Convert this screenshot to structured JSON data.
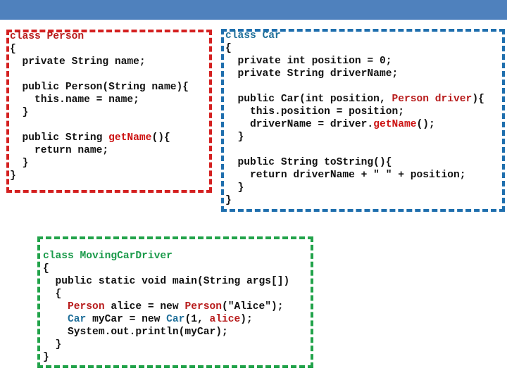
{
  "colors": {
    "header": "#4f81bd",
    "person": "#cc1111",
    "car": "#1f6f9a",
    "driver": "#1a9a4a",
    "text": "#111111"
  },
  "boxes": [
    {
      "id": "person",
      "border": "#d42020",
      "lines": [
        [
          {
            "t": "class Person",
            "c": "#b81c1c"
          }
        ],
        [
          {
            "t": "{"
          }
        ],
        [
          {
            "t": "  private String name;"
          }
        ],
        [
          {
            "t": ""
          }
        ],
        [
          {
            "t": "  public Person(String name){"
          }
        ],
        [
          {
            "t": "    this.name = name;"
          }
        ],
        [
          {
            "t": "  }"
          }
        ],
        [
          {
            "t": ""
          }
        ],
        [
          {
            "t": "  public String "
          },
          {
            "t": "getName",
            "c": "#cc1111"
          },
          {
            "t": "(){"
          }
        ],
        [
          {
            "t": "    return name;"
          }
        ],
        [
          {
            "t": "  }"
          }
        ],
        [
          {
            "t": "}"
          }
        ]
      ]
    },
    {
      "id": "car",
      "border": "#1f6fae",
      "lines": [
        [
          {
            "t": "class Car",
            "c": "#1f6f9a"
          }
        ],
        [
          {
            "t": "{"
          }
        ],
        [
          {
            "t": "  private int position = 0;"
          }
        ],
        [
          {
            "t": "  private String driverName;"
          }
        ],
        [
          {
            "t": ""
          }
        ],
        [
          {
            "t": "  public Car(int position, "
          },
          {
            "t": "Person driver",
            "c": "#b81c1c"
          },
          {
            "t": "){"
          }
        ],
        [
          {
            "t": "    this.position = position;"
          }
        ],
        [
          {
            "t": "    driverName = driver."
          },
          {
            "t": "getName",
            "c": "#cc1111"
          },
          {
            "t": "();"
          }
        ],
        [
          {
            "t": "  }"
          }
        ],
        [
          {
            "t": ""
          }
        ],
        [
          {
            "t": "  public String toString(){"
          }
        ],
        [
          {
            "t": "    return driverName + \" \" + position;"
          }
        ],
        [
          {
            "t": "  }"
          }
        ],
        [
          {
            "t": "}"
          }
        ]
      ]
    },
    {
      "id": "moving-car-driver",
      "border": "#22a34a",
      "lines": [
        [
          {
            "t": "class MovingCarDriver",
            "c": "#1a9a4a"
          }
        ],
        [
          {
            "t": "{"
          }
        ],
        [
          {
            "t": "  public static void main(String args[])"
          }
        ],
        [
          {
            "t": "  {"
          }
        ],
        [
          {
            "t": "    "
          },
          {
            "t": "Person",
            "c": "#b81c1c"
          },
          {
            "t": " alice = new "
          },
          {
            "t": "Person",
            "c": "#b81c1c"
          },
          {
            "t": "(\"Alice\");"
          }
        ],
        [
          {
            "t": "    "
          },
          {
            "t": "Car",
            "c": "#1f6f9a"
          },
          {
            "t": " myCar = new "
          },
          {
            "t": "Car",
            "c": "#1f6f9a"
          },
          {
            "t": "(1, "
          },
          {
            "t": "alice",
            "c": "#b81c1c"
          },
          {
            "t": ");"
          }
        ],
        [
          {
            "t": "    System.out.println(myCar);"
          }
        ],
        [
          {
            "t": "  }"
          }
        ],
        [
          {
            "t": "}"
          }
        ]
      ]
    }
  ]
}
